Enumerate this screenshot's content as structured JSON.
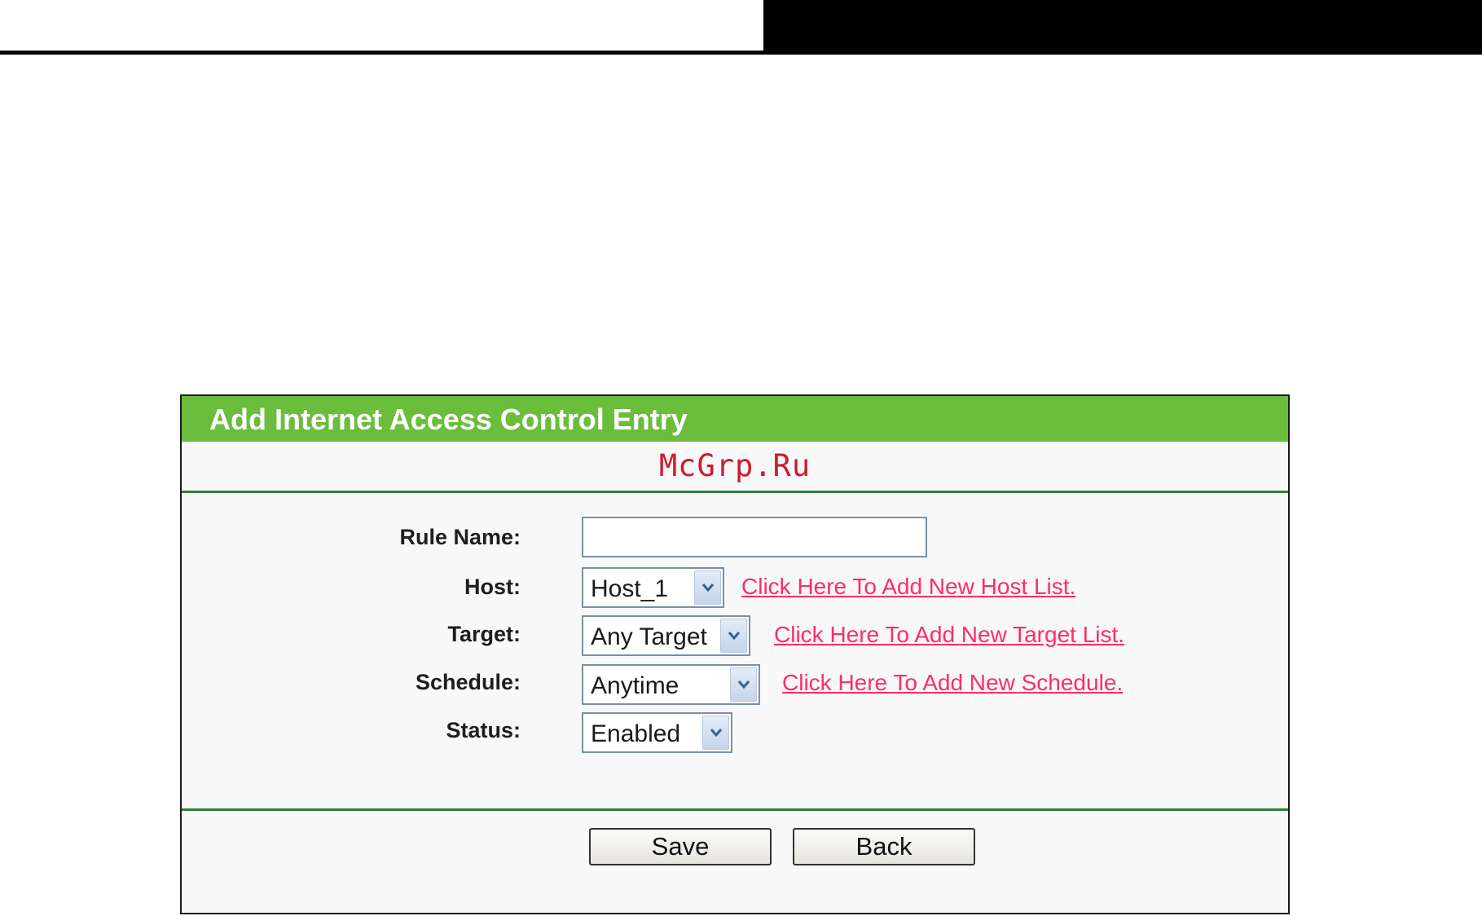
{
  "panel": {
    "title": "Add Internet Access Control Entry",
    "watermark": "McGrp.Ru"
  },
  "form": {
    "rule_name": {
      "label": "Rule Name:",
      "value": ""
    },
    "host": {
      "label": "Host:",
      "selected": "Host_1",
      "link": "Click Here To Add New Host List."
    },
    "target": {
      "label": "Target:",
      "selected": "Any Target",
      "link": "Click Here To Add New Target List."
    },
    "schedule": {
      "label": "Schedule:",
      "selected": "Anytime",
      "link": "Click Here To Add New Schedule."
    },
    "status": {
      "label": "Status:",
      "selected": "Enabled"
    }
  },
  "buttons": {
    "save": "Save",
    "back": "Back"
  },
  "colors": {
    "title_bar": "#6bbd3c",
    "divider": "#2f7d3b",
    "link": "#ff2d67",
    "watermark": "#cc1b2e"
  },
  "icons": {
    "dropdown": "chevron-down-icon"
  }
}
